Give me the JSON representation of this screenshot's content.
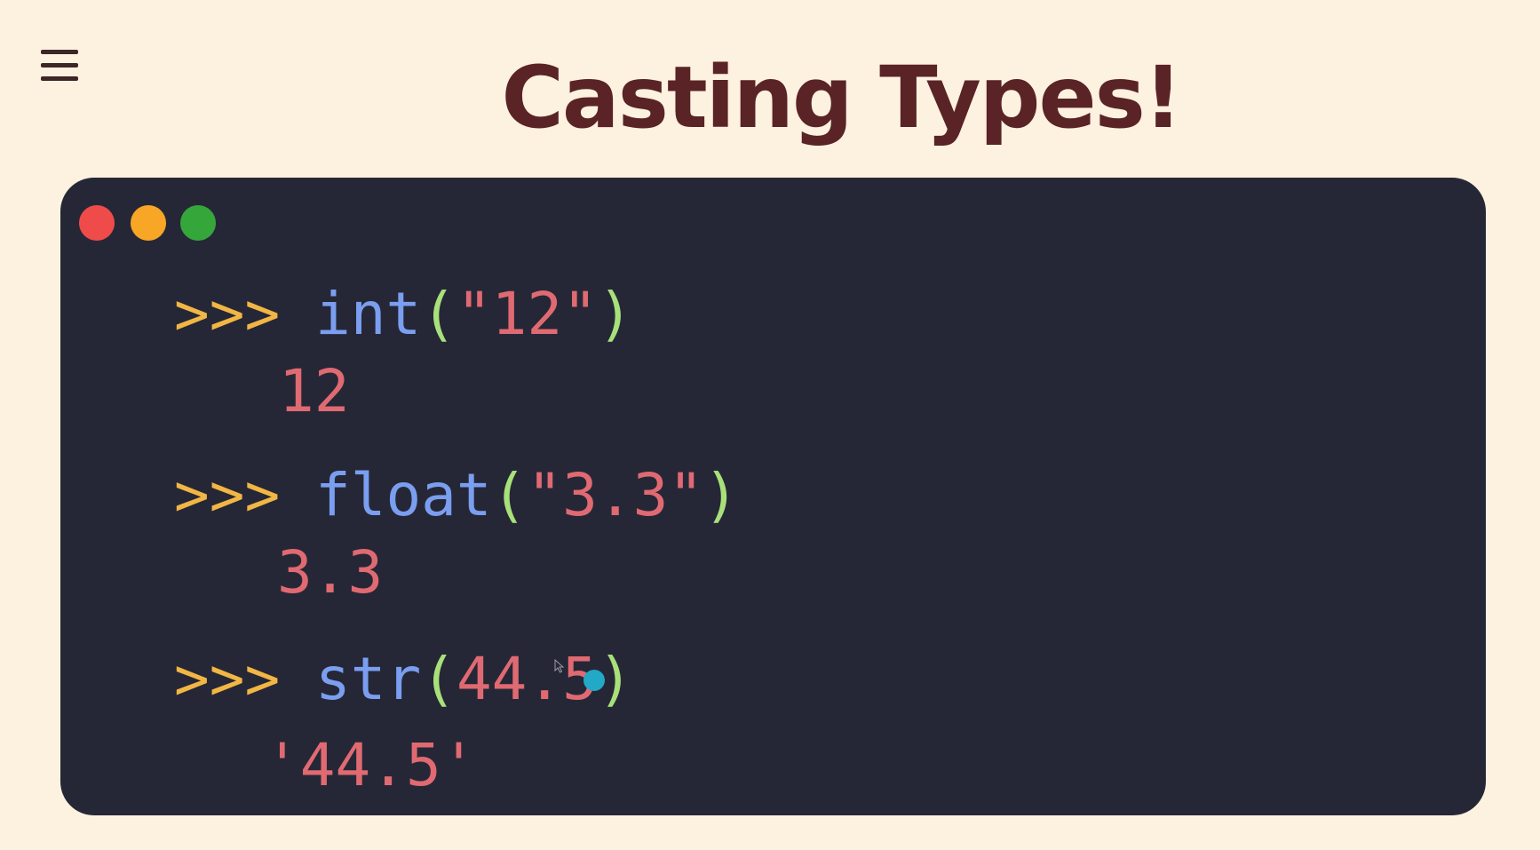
{
  "header": {
    "menu_icon": "hamburger-menu-icon",
    "title": "Casting Types!"
  },
  "terminal": {
    "window_dots": [
      {
        "name": "close",
        "color": "#ef4b4b"
      },
      {
        "name": "minimize",
        "color": "#f7a625"
      },
      {
        "name": "maximize",
        "color": "#34a63a"
      }
    ],
    "colors": {
      "background": "#262736",
      "prompt": "#f1b644",
      "function": "#7a9ef0",
      "paren": "#a8e07a",
      "string": "#e06a72"
    },
    "entries": [
      {
        "prompt": ">>>",
        "func": "int",
        "open_paren": "(",
        "arg": "\"12\"",
        "close_paren": ")",
        "output": "12"
      },
      {
        "prompt": ">>>",
        "func": "float",
        "open_paren": "(",
        "arg": "\"3.3\"",
        "close_paren": ")",
        "output": "3.3"
      },
      {
        "prompt": ">>>",
        "func": "str",
        "open_paren": "(",
        "arg": "44.5",
        "close_paren": ")",
        "output": "'44.5'"
      }
    ]
  }
}
